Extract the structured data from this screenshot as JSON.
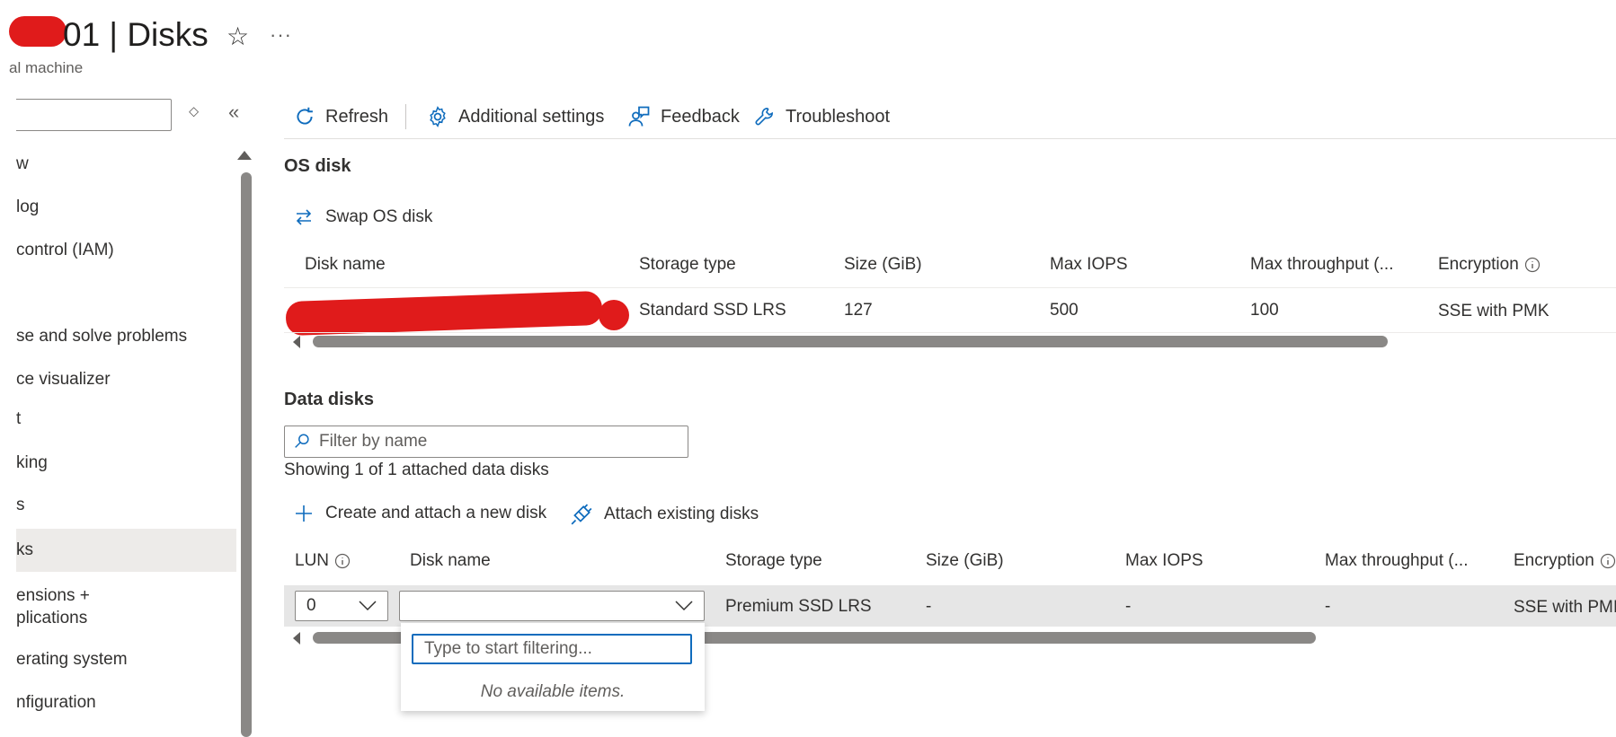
{
  "header": {
    "title": "01 | Disks",
    "subtitle": "al machine",
    "favorite_icon": "star-icon",
    "more_label": "···"
  },
  "sidebar": {
    "items": [
      {
        "label": "w"
      },
      {
        "label": "log"
      },
      {
        "label": "control (IAM)"
      },
      {
        "label": "se and solve problems"
      },
      {
        "label": "ce visualizer"
      },
      {
        "label": "t"
      },
      {
        "label": "king"
      },
      {
        "label": "s"
      },
      {
        "label": "ks",
        "selected": true
      },
      {
        "label": "ensions +"
      },
      {
        "label": "plications"
      },
      {
        "label": "erating system"
      },
      {
        "label": "nfiguration"
      }
    ]
  },
  "toolbar": {
    "refresh": "Refresh",
    "additional_settings": "Additional settings",
    "feedback": "Feedback",
    "troubleshoot": "Troubleshoot"
  },
  "os_disk": {
    "section_title": "OS disk",
    "swap_label": "Swap OS disk",
    "columns": [
      "Disk name",
      "Storage type",
      "Size (GiB)",
      "Max IOPS",
      "Max throughput (...",
      "Encryption"
    ],
    "row": {
      "storage_type": "Standard SSD LRS",
      "size": "127",
      "max_iops": "500",
      "max_throughput": "100",
      "encryption": "SSE with PMK"
    }
  },
  "data_disks": {
    "section_title": "Data disks",
    "filter_placeholder": "Filter by name",
    "showing_text": "Showing 1 of 1 attached data disks",
    "create_label": "Create and attach a new disk",
    "attach_label": "Attach existing disks",
    "columns": [
      "LUN",
      "Disk name",
      "Storage type",
      "Size (GiB)",
      "Max IOPS",
      "Max throughput (...",
      "Encryption"
    ],
    "row": {
      "lun": "0",
      "disk_name": "",
      "storage_type": "Premium SSD LRS",
      "size": "-",
      "max_iops": "-",
      "max_throughput": "-",
      "encryption": "SSE with PMI"
    },
    "dropdown": {
      "filter_placeholder": "Type to start filtering...",
      "empty_text": "No available items."
    }
  },
  "colors": {
    "accent": "#0f6cbd",
    "redaction": "#e01b1b",
    "selected_bg": "#edebe9",
    "row_bg": "#e6e6e6"
  }
}
